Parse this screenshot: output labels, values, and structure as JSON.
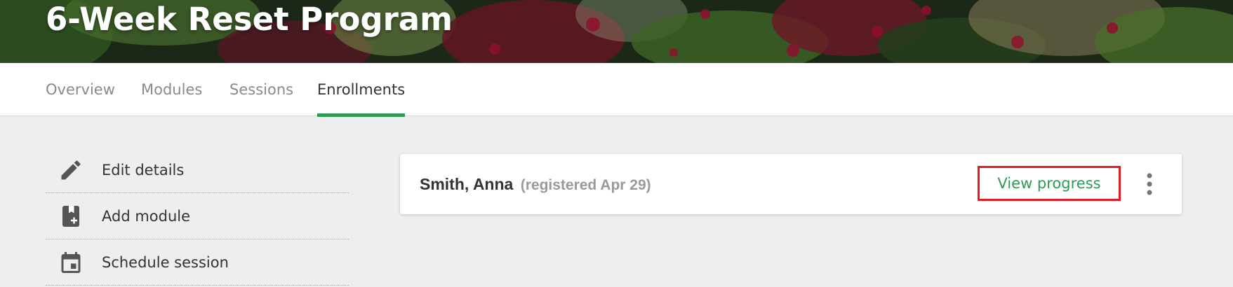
{
  "header": {
    "title": "6-Week Reset Program"
  },
  "tabs": [
    {
      "label": "Overview",
      "active": false
    },
    {
      "label": "Modules",
      "active": false
    },
    {
      "label": "Sessions",
      "active": false
    },
    {
      "label": "Enrollments",
      "active": true
    }
  ],
  "sidebar": {
    "items": [
      {
        "label": "Edit details",
        "icon": "pencil-icon"
      },
      {
        "label": "Add module",
        "icon": "add-module-icon"
      },
      {
        "label": "Schedule session",
        "icon": "calendar-icon"
      }
    ]
  },
  "enrollment": {
    "name": "Smith, Anna",
    "registered": "(registered Apr 29)",
    "view_progress_label": "View progress",
    "more_icon": "more-vertical-icon"
  },
  "colors": {
    "accent_green": "#2e9a57",
    "highlight_red": "#e01b24",
    "icon_gray": "#555555"
  }
}
